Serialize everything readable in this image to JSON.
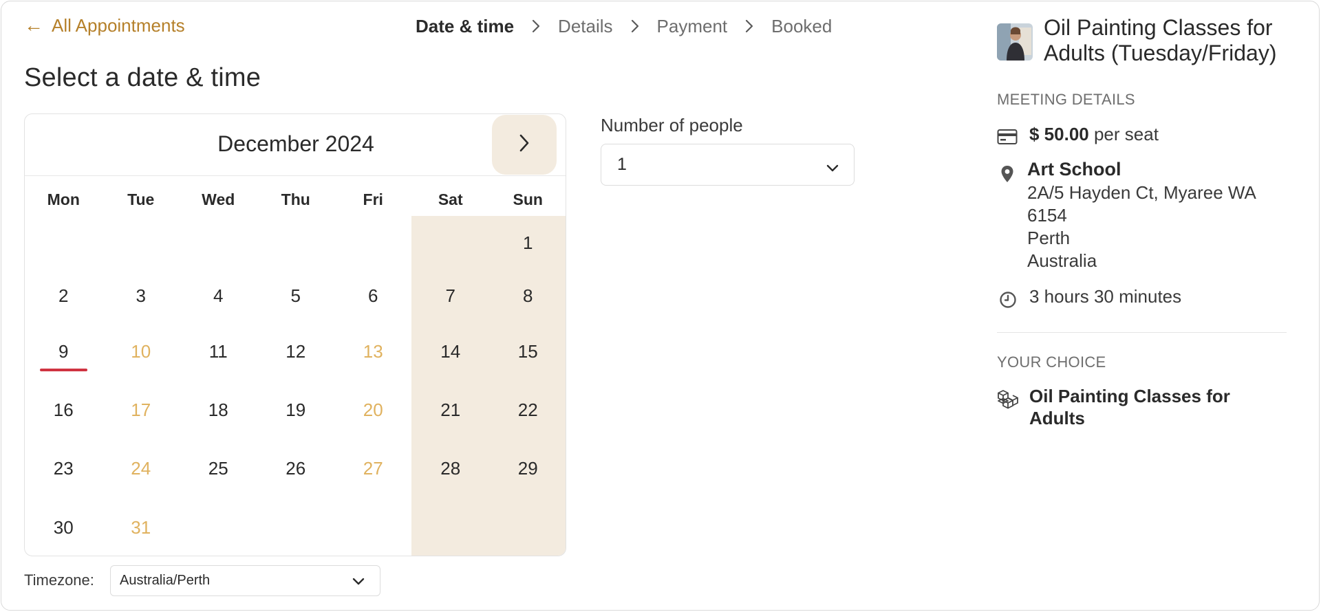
{
  "back_link": {
    "label": "All Appointments"
  },
  "steps": [
    {
      "label": "Date & time",
      "active": true
    },
    {
      "label": "Details",
      "active": false
    },
    {
      "label": "Payment",
      "active": false
    },
    {
      "label": "Booked",
      "active": false
    }
  ],
  "page_title": "Select a date & time",
  "calendar": {
    "month_label": "December 2024",
    "weekdays": [
      "Mon",
      "Tue",
      "Wed",
      "Thu",
      "Fri",
      "Sat",
      "Sun"
    ],
    "weeks": [
      [
        "",
        "",
        "",
        "",
        "",
        "",
        "1"
      ],
      [
        "2",
        "3",
        "4",
        "5",
        "6",
        "7",
        "8"
      ],
      [
        "9",
        "10",
        "11",
        "12",
        "13",
        "14",
        "15"
      ],
      [
        "16",
        "17",
        "18",
        "19",
        "20",
        "21",
        "22"
      ],
      [
        "23",
        "24",
        "25",
        "26",
        "27",
        "28",
        "29"
      ],
      [
        "30",
        "31",
        "",
        "",
        "",
        "",
        ""
      ]
    ],
    "available_days": [
      "10",
      "13",
      "17",
      "20",
      "24",
      "27",
      "31"
    ],
    "today": "9"
  },
  "timezone": {
    "label": "Timezone:",
    "value": "Australia/Perth"
  },
  "people": {
    "label": "Number of people",
    "value": "1"
  },
  "service": {
    "title": "Oil Painting Classes for Adults (Tuesday/Friday)"
  },
  "meeting_details": {
    "section_label": "MEETING DETAILS",
    "price_amount": "$ 50.00",
    "price_suffix": " per seat",
    "location_name": "Art School",
    "address_lines": [
      "2A/5 Hayden Ct, Myaree WA 6154",
      "Perth",
      "Australia"
    ],
    "duration": "3 hours 30 minutes"
  },
  "your_choice": {
    "section_label": "YOUR CHOICE",
    "item": "Oil Painting Classes for Adults"
  },
  "colors": {
    "accent": "#b5802a",
    "available_day": "#e0b25f",
    "weekend_bg": "#f3ebdf",
    "today_underline": "#cf3341"
  },
  "icons": {
    "back": "arrow-left-icon",
    "step_separator": "chevron-right-icon",
    "next_month": "chevron-right-icon",
    "select": "chevron-down-icon",
    "price": "credit-card-icon",
    "location": "map-pin-icon",
    "duration": "clock-icon",
    "choice": "cubes-icon"
  }
}
